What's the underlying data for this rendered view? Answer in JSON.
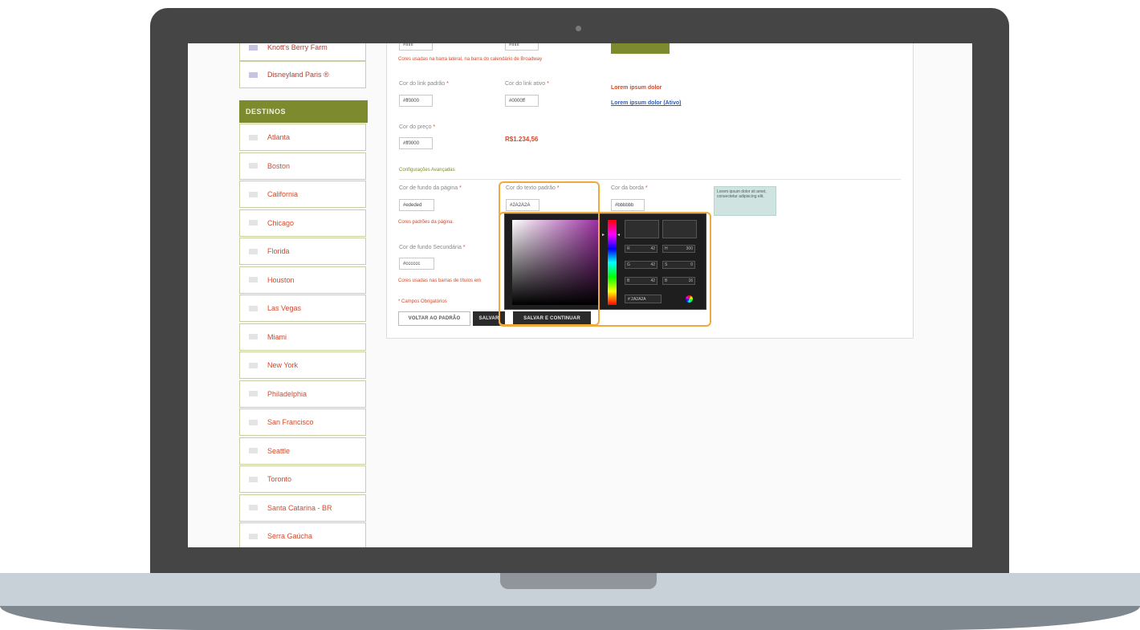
{
  "sidebar": {
    "top_items": [
      {
        "label": "Knott's Berry Farm"
      },
      {
        "label": "Disneyland Paris ®"
      }
    ],
    "header": "DESTINOS",
    "items": [
      {
        "label": "Atlanta"
      },
      {
        "label": "Boston"
      },
      {
        "label": "California"
      },
      {
        "label": "Chicago"
      },
      {
        "label": "Florida"
      },
      {
        "label": "Houston"
      },
      {
        "label": "Las Vegas"
      },
      {
        "label": "Miami"
      },
      {
        "label": "New York"
      },
      {
        "label": "Philadelphia"
      },
      {
        "label": "San Francisco"
      },
      {
        "label": "Seattle"
      },
      {
        "label": "Toronto"
      },
      {
        "label": "Santa Catarina - BR"
      },
      {
        "label": "Serra Gaúcha"
      }
    ]
  },
  "form": {
    "top_inputs": [
      "#ffffff",
      "#ffffff"
    ],
    "help_top": "Cores usadas na barra lateral, na barra do calendário de Broadway",
    "link_color_label": "Cor do link padrão",
    "link_color_value": "#ff0000",
    "active_link_label": "Cor do link ativo",
    "active_link_value": "#0000ff",
    "sample_text": "Lorem ipsum dolor",
    "sample_link": "Lorem ipsum dolor (Ativo)",
    "price_color_label": "Cor do preço",
    "price_color_value": "#ff0000",
    "price_sample": "R$1.234,56",
    "section_title": "Configurações Avançadas",
    "page_bg_label": "Cor de fundo da página",
    "page_bg_value": "#ededed",
    "text_color_label": "Cor do texto padrão",
    "text_color_value": "#2A2A2A",
    "border_color_label": "Cor da borda",
    "border_color_value": "#bbbbbb",
    "help_page": "Cores padrões da página.",
    "secondary_bg_label": "Cor de fundo Secundária",
    "secondary_bg_value": "#cccccc",
    "help_secondary": "Cores usadas nas barras de títulos em",
    "teal_sample": "Lorem ipsum dolor sit amet, consectetur adipiscing elit.",
    "required_note": "* Campos Obrigatórios",
    "required_mark": "*",
    "btn_default": "VOLTAR AO PADRÃO",
    "btn_save": "SALVAR",
    "btn_save_continue": "SALVAR E CONTINUAR"
  },
  "picker": {
    "hex": "2A2A2A",
    "fields": [
      {
        "key": "R",
        "value": "42"
      },
      {
        "key": "H",
        "value": "300"
      },
      {
        "key": "G",
        "value": "42"
      },
      {
        "key": "S",
        "value": "0"
      },
      {
        "key": "B",
        "value": "42"
      },
      {
        "key": "B",
        "value": "16"
      }
    ],
    "hex_key": "#",
    "saturation_color": "#9a2fa0",
    "highlight_color": "#f0a93a"
  }
}
